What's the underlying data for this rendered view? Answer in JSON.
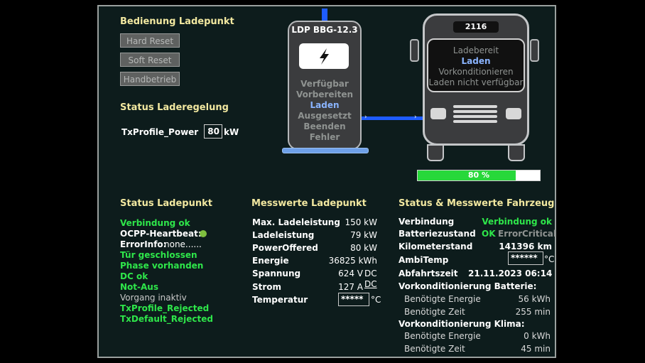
{
  "bedienung": {
    "title": "Bedienung Ladepunkt",
    "buttons": [
      "Hard Reset",
      "Soft Reset",
      "Handbetrieb"
    ]
  },
  "laderegelung": {
    "title": "Status Laderegelung",
    "label": "TxProfile_Power",
    "value": "80",
    "unit": "kW"
  },
  "station": {
    "name": "LDP BBG-12.3",
    "states": [
      "Verfügbar",
      "Vorbereiten",
      "Laden",
      "Ausgesetzt",
      "Beenden",
      "Fehler"
    ],
    "active_state": "Laden",
    "icon": "lightning-bolt-icon"
  },
  "bus": {
    "number": "2116",
    "states": [
      "Ladebereit",
      "Laden",
      "Vorkonditionieren",
      "Laden nicht verfügbar"
    ],
    "active_state": "Laden",
    "soc_percent": 80,
    "soc_label": "80 %"
  },
  "status_ladepunkt": {
    "title": "Status Ladepunkt",
    "verbindung": "Verbindung ok",
    "heartbeat_label": "OCPP-Heartbeat:",
    "error_label": "ErrorInfo:",
    "error_value": "none......",
    "items": [
      "Tür geschlossen",
      "Phase vorhanden",
      "DC ok",
      "Not-Aus"
    ],
    "vorgang": "Vorgang inaktiv",
    "rejects": [
      "TxProfile_Rejected",
      "TxDefault_Rejected"
    ]
  },
  "messwerte": {
    "title": "Messwerte Ladepunkt",
    "rows": [
      {
        "label": "Max. Ladeleistung",
        "value": "150 kW"
      },
      {
        "label": "Ladeleistung",
        "value": "79 kW"
      },
      {
        "label": "PowerOffered",
        "value": "80 kW"
      },
      {
        "label": "Energie",
        "value": "36825 kWh"
      },
      {
        "label": "Spannung",
        "value": "624 V",
        "suffix": "DC"
      },
      {
        "label": "Strom",
        "value": "127 A",
        "suffix": "DC"
      }
    ],
    "temperatur_label": "Temperatur",
    "temperatur_value": "*****",
    "temperatur_unit": "°C"
  },
  "fahrzeug": {
    "title": "Status & Messwerte Fahrzeug",
    "verbindung_label": "Verbindung",
    "verbindung_value": "Verbindung ok",
    "batterie_label": "Batteriezustand",
    "batterie_ok": "OK",
    "batterie_error": "Error",
    "batterie_critical": "Critical",
    "km_label": "Kilometerstand",
    "km_value": "141396 km",
    "ambi_label": "AmbiTemp",
    "ambi_value": "******",
    "ambi_unit": "°C",
    "abfahrt_label": "Abfahrtszeit",
    "abfahrt_value": "21.11.2023 06:14",
    "vk_batterie": "Vorkonditionierung Batterie:",
    "vk_klima": "Vorkonditionierung Klima:",
    "energie_label": "Benötigte Energie",
    "zeit_label": "Benötigte Zeit",
    "batt_energie": "56 kWh",
    "batt_zeit": "255 min",
    "klima_energie": "0 kWh",
    "klima_zeit": "45 min"
  },
  "colors": {
    "green": "#2ee64a",
    "blue": "#1e5cff",
    "highlight": "#8ab4ff"
  }
}
